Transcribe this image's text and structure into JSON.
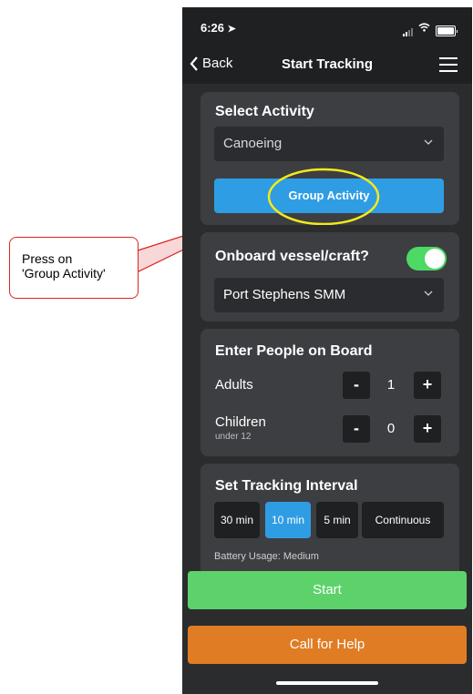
{
  "status": {
    "time": "6:26"
  },
  "nav": {
    "back_label": "Back",
    "title": "Start Tracking"
  },
  "select_activity": {
    "title": "Select Activity",
    "selected": "Canoeing",
    "group_button": "Group Activity"
  },
  "onboard": {
    "title": "Onboard vessel/craft?",
    "toggle_on": true,
    "vessel": "Port Stephens SMM"
  },
  "people": {
    "title": "Enter People on Board",
    "adults_label": "Adults",
    "adults_value": "1",
    "children_label": "Children",
    "children_sub": "under 12",
    "children_value": "0",
    "minus": "-",
    "plus": "+"
  },
  "interval": {
    "title": "Set Tracking Interval",
    "options": [
      "30 min",
      "10 min",
      "5 min",
      "Continuous"
    ],
    "selected": "10 min",
    "battery": "Battery Usage: Medium"
  },
  "actions": {
    "start": "Start",
    "help": "Call for Help"
  },
  "callout": {
    "line1": "Press on",
    "line2": "'Group Activity'"
  },
  "colors": {
    "accent_blue": "#2f9de4",
    "start_green": "#5dd26b",
    "help_orange": "#e07c23",
    "annotation_red": "#dd2222",
    "highlight_yellow": "#f2ea1a"
  }
}
